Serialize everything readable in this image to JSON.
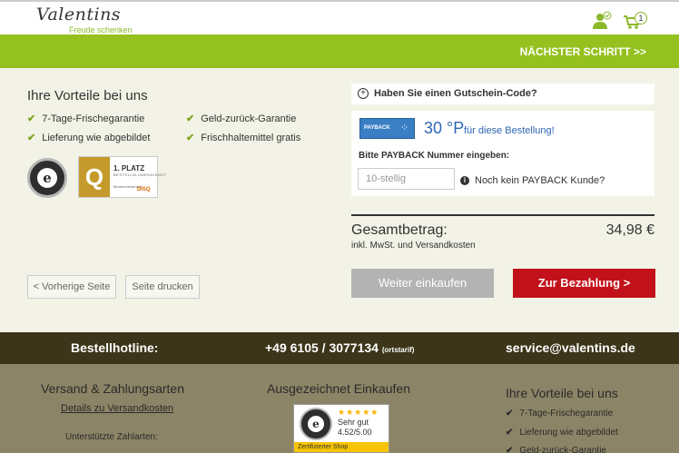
{
  "header": {
    "logo_text": "Valentins",
    "logo_tagline": "Freude schenken",
    "cart_count": "1",
    "next_step": "NÄCHSTER SCHRITT >>"
  },
  "advantages": {
    "title": "Ihre Vorteile bei uns",
    "items": [
      "7-Tage-Frischegarantie",
      "Geld-zurück-Garantie",
      "Lieferung wie abgebildet",
      "Frischhaltemittel gratis"
    ]
  },
  "badges": {
    "first_place_title": "1. PLATZ",
    "first_place_sub": "BESTELLBLUMENDIENST",
    "first_place_caption": "Blumenversender",
    "first_place_brand": "DISQ"
  },
  "nav_buttons": {
    "previous": "< Vorherige Seite",
    "print": "Seite drucken"
  },
  "voucher": {
    "label": "Haben Sie einen Gutschein-Code?"
  },
  "payback": {
    "logo": "PAYBACK",
    "points": "30 °P",
    "points_suffix": "für diese Bestellung!",
    "number_label": "Bitte PAYBACK Nummer eingeben:",
    "input_placeholder": "10-stellig",
    "no_customer": "Noch kein PAYBACK Kunde?"
  },
  "total": {
    "label": "Gesamtbetrag:",
    "sub": "inkl. MwSt. und Versandkosten",
    "value": "34,98 €"
  },
  "actions": {
    "continue_shopping": "Weiter einkaufen",
    "checkout": "Zur Bezahlung >"
  },
  "hotline": {
    "label": "Bestellhotline:",
    "phone": "+49 6105 / 3077134",
    "phone_note": "(ortstarif)",
    "email": "service@valentins.de"
  },
  "footer": {
    "shipping_title": "Versand & Zahlungsarten",
    "shipping_link": "Details zu Versandkosten",
    "payments_label": "Unterstützte Zahlarten:",
    "award_title": "Ausgezeichnet Einkaufen",
    "ts_stars": "★★★★★",
    "ts_rating_word": "Sehr gut",
    "ts_rating": "4.52/5.00",
    "ts_caption": "Zertifizierter Shop",
    "adv_title": "Ihre Vorteile bei uns",
    "adv_items": [
      "7-Tage-Frischegarantie",
      "Lieferung wie abgebildet",
      "Geld-zurück-Garantie"
    ]
  },
  "colors": {
    "green": "#95c11f",
    "checkout_red": "#c2111a",
    "hotline_bg": "#3c3519",
    "footer_bg": "#8c8466",
    "payback_blue": "#2f66b3"
  }
}
